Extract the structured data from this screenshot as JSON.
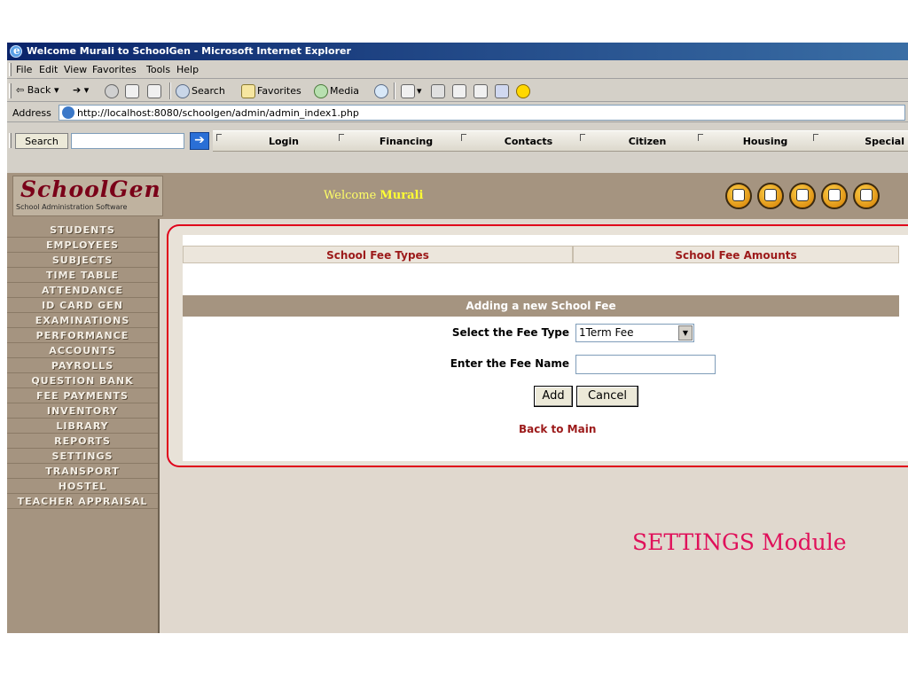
{
  "window": {
    "title": "Welcome Murali to SchoolGen - Microsoft Internet Explorer"
  },
  "menu": [
    "File",
    "Edit",
    "View",
    "Favorites",
    "Tools",
    "Help"
  ],
  "toolbar": {
    "back": "Back",
    "search": "Search",
    "favorites": "Favorites",
    "media": "Media"
  },
  "address": {
    "label": "Address",
    "url": "http://localhost:8080/schoolgen/admin/admin_index1.php"
  },
  "searchbar": {
    "search_label": "Search",
    "search_value": "",
    "go_symbol": "➔"
  },
  "nav_tabs": [
    "Login",
    "Financing",
    "Contacts",
    "Citizen",
    "Housing",
    "Special"
  ],
  "header": {
    "logo_text": "SchoolGen",
    "logo_subtitle": "School Administration Software",
    "welcome_prefix": "Welcome",
    "welcome_name": "Murali",
    "icons": [
      "home-icon",
      "book-icon",
      "globe-icon",
      "certificate-icon",
      "help-icon"
    ]
  },
  "sidebar": {
    "items": [
      "STUDENTS",
      "EMPLOYEES",
      "SUBJECTS",
      "TIME TABLE",
      "ATTENDANCE",
      "ID CARD GEN",
      "EXAMINATIONS",
      "PERFORMANCE",
      "ACCOUNTS",
      "PAYROLLS",
      "QUESTION BANK",
      "FEE PAYMENTS",
      "INVENTORY",
      "LIBRARY",
      "REPORTS",
      "SETTINGS",
      "TRANSPORT",
      "HOSTEL",
      "TEACHER APPRAISAL"
    ]
  },
  "tabs": {
    "fee_types": "School Fee Types",
    "fee_amounts": "School Fee Amounts"
  },
  "form": {
    "heading": "Adding a new School Fee",
    "fee_type_label": "Select the Fee Type",
    "fee_type_value": "1Term Fee",
    "fee_name_label": "Enter the Fee Name",
    "fee_name_value": "",
    "add_label": "Add",
    "cancel_label": "Cancel",
    "back_link": "Back to Main"
  },
  "module_label": "SETTINGS Module",
  "colors": {
    "accent": "#a59480",
    "link": "#9c1a1a",
    "panel_border": "#e0001a",
    "module_label": "#e0105a",
    "welcome_name": "#ffff33"
  }
}
